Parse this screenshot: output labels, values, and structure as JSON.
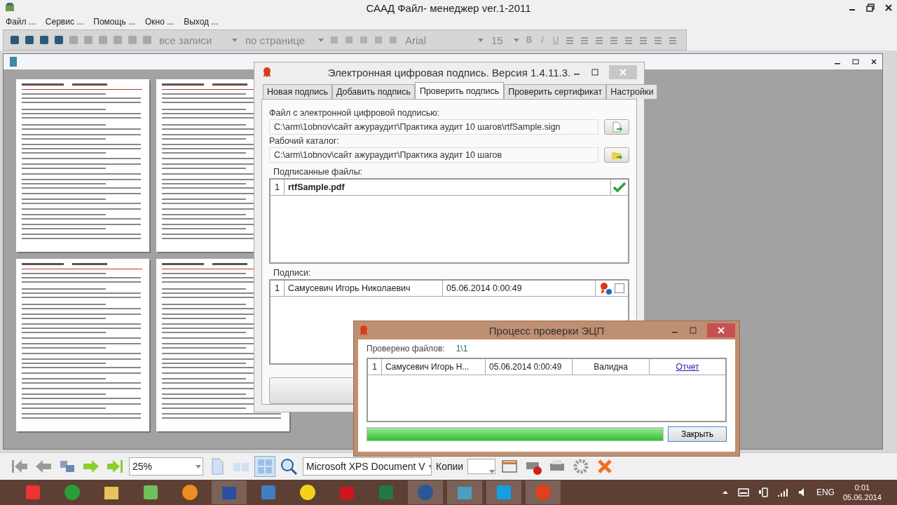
{
  "window": {
    "title": "САAД Файл- менеджер ver.1-2011"
  },
  "menu": [
    "Файл ...",
    "Сервис ...",
    "Помощь ...",
    "Окно ...",
    "Выход ..."
  ],
  "toolbar": {
    "record_filter": "все записи",
    "paging": "по странице",
    "font": "Arial",
    "font_size": "15",
    "format_buttons": [
      "B",
      "I",
      "U"
    ]
  },
  "signature_dialog": {
    "title": "Электронная цифровая подпись. Версия 1.4.11.3.",
    "tabs": [
      {
        "label": "Новая подпись",
        "selected": false
      },
      {
        "label": "Добавить подпись",
        "selected": false
      },
      {
        "label": "Проверить подпись",
        "selected": true
      },
      {
        "label": "Проверить сертификат",
        "selected": false
      },
      {
        "label": "Настройки",
        "selected": false
      }
    ],
    "file_label": "Файл с электронной цифровой подписью:",
    "file_value": "C:\\arm\\1obnov\\сайт ажураудит\\Практика аудит 10 шагов\\rtfSample.sign",
    "dir_label": "Рабочий каталог:",
    "dir_value": "C:\\arm\\1obnov\\сайт ажураудит\\Практика аудит 10 шагов",
    "signed_files_label": "Подписанные файлы:",
    "signed_files": [
      {
        "number": "1",
        "name": "rtfSample.pdf",
        "verified": true
      }
    ],
    "signatures_label": "Подписи:",
    "signatures": [
      {
        "number": "1",
        "signer": "Самусевич Игорь Николаевич",
        "date": "05.06.2014 0:00:49",
        "checked": false
      }
    ]
  },
  "process_dialog": {
    "title": "Процесс проверки ЭЦП",
    "checked_label": "Проверено файлов:",
    "checked_count": "1\\1",
    "rows": [
      {
        "number": "1",
        "signer": "Самусевич Игорь Н...",
        "date": "05.06.2014 0:00:49",
        "status": "Валидна",
        "link": "Отчет"
      }
    ],
    "progress": {
      "level": 1
    },
    "close_button": "Закрыть"
  },
  "bottom_toolbar": {
    "zoom": "25%",
    "printer": "Microsoft XPS Document V",
    "copies_label": "Копии"
  },
  "taskbar": {
    "language": "ENG",
    "time": "0:01",
    "date": "05.06.2014"
  }
}
